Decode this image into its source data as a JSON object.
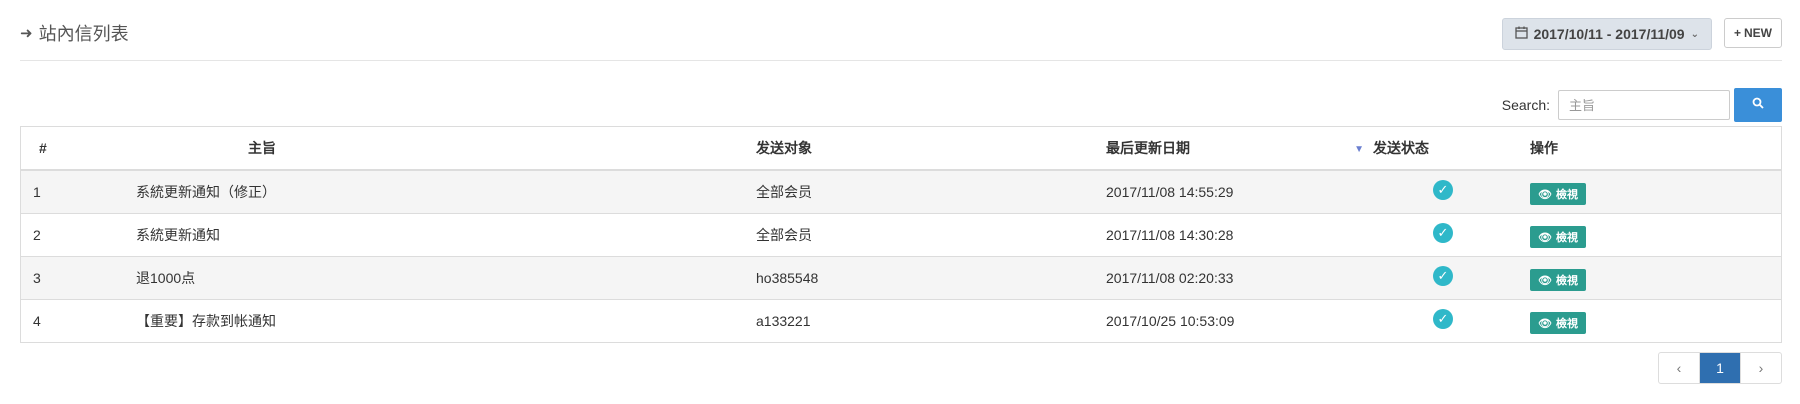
{
  "page": {
    "title": "站內信列表",
    "title_icon": "sign-in-icon"
  },
  "toolbar": {
    "date_range": "2017/10/11 - 2017/11/09",
    "new_label": "NEW"
  },
  "search": {
    "label": "Search:",
    "placeholder": "主旨",
    "value": ""
  },
  "table": {
    "headers": {
      "num": "#",
      "subject": "主旨",
      "target": "发送对象",
      "date": "最后更新日期",
      "status": "发送状态",
      "ops": "操作"
    },
    "rows": [
      {
        "num": "1",
        "subject": "系統更新通知（修正）",
        "target": "全部会员",
        "date": "2017/11/08 14:55:29",
        "status": "sent",
        "action": "檢視"
      },
      {
        "num": "2",
        "subject": "系統更新通知",
        "target": "全部会员",
        "date": "2017/11/08 14:30:28",
        "status": "sent",
        "action": "檢視"
      },
      {
        "num": "3",
        "subject": "退1000点",
        "target": "ho385548",
        "date": "2017/11/08 02:20:33",
        "status": "sent",
        "action": "檢視"
      },
      {
        "num": "4",
        "subject": "【重要】存款到帐通知",
        "target": "a133221",
        "date": "2017/10/25 10:53:09",
        "status": "sent",
        "action": "檢視"
      }
    ]
  },
  "pagination": {
    "current": "1",
    "prev": "‹",
    "next": "›"
  },
  "colors": {
    "primary": "#3a8fd9",
    "view_button": "#2b9c8f",
    "status_check": "#2fb8c9",
    "page_active": "#2f6fb0"
  }
}
